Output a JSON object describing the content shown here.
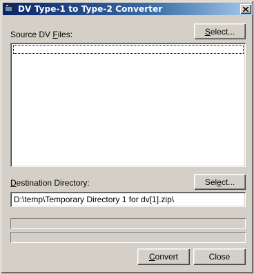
{
  "window": {
    "title": "DV Type-1 to Type-2 Converter",
    "icon": "app-icon",
    "close_label": "×"
  },
  "source": {
    "label_pre": "Source DV ",
    "label_mnemonic": "F",
    "label_post": "iles:",
    "select_pre": "",
    "select_mnemonic": "S",
    "select_post": "elect...",
    "files": []
  },
  "destination": {
    "label_pre": "",
    "label_mnemonic": "D",
    "label_post": "estination Directory:",
    "select_pre": "Sel",
    "select_mnemonic": "e",
    "select_post": "ct...",
    "value": "D:\\temp\\Temporary Directory 1 for dv[1].zip\\"
  },
  "progress": {
    "bar1_value": 0,
    "bar2_value": 0
  },
  "actions": {
    "convert_pre": "",
    "convert_mnemonic": "C",
    "convert_post": "onvert",
    "close_label": "Close"
  }
}
